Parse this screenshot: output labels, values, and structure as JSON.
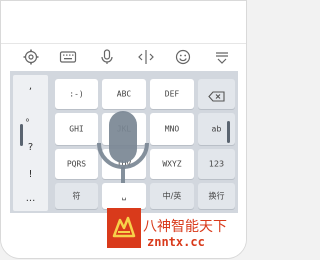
{
  "toolbar": {
    "icons": [
      "gear-icon",
      "keyboard-icon",
      "microphone-icon",
      "cursor-move-icon",
      "emoji-icon",
      "hide-keyboard-icon"
    ]
  },
  "symbols": [
    ",",
    "。",
    "?",
    "!",
    "..."
  ],
  "keys": {
    "row1": ":-)",
    "abc": "ABC",
    "def": "DEF",
    "ghi": "GHI",
    "jkl": "JKL",
    "mno": "MNO",
    "pqrs": "PQRS",
    "tuv": "TUV",
    "wxyz": "WXYZ",
    "ab": "ab",
    "num": "123",
    "sym": "符",
    "space": "␣",
    "lang": "中/英",
    "newline": "换行"
  },
  "watermark": {
    "line1": "八神智能天下",
    "line2": "znntx.cc"
  },
  "colors": {
    "keyboard_bg": "#d2d7de",
    "mic": "#7a8794",
    "watermark": "#d93a1b"
  }
}
